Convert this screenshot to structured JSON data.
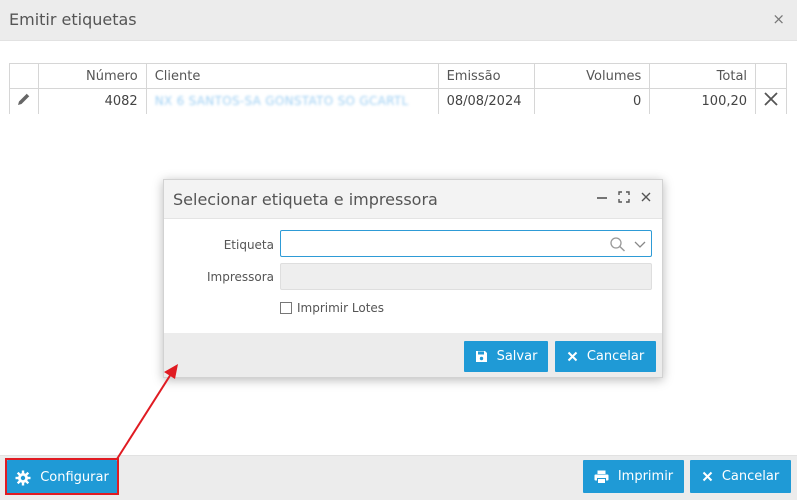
{
  "window": {
    "title": "Emitir etiquetas",
    "close_glyph": "×"
  },
  "table": {
    "columns": [
      "",
      "Número",
      "Cliente",
      "Emissão",
      "Volumes",
      "Total",
      ""
    ],
    "rows": [
      {
        "numero": "4082",
        "cliente": "NX 6 SANTOS-SA GONSTATO SO GCARTL",
        "emissao": "08/08/2024",
        "volumes": "0",
        "total": "100,20"
      }
    ]
  },
  "dialog": {
    "title": "Selecionar etiqueta e impressora",
    "etiqueta_label": "Etiqueta",
    "etiqueta_value": "",
    "impressora_label": "Impressora",
    "impressora_value": "",
    "imprimir_lotes_label": "Imprimir Lotes",
    "imprimir_lotes_checked": false,
    "save_label": "Salvar",
    "cancel_label": "Cancelar"
  },
  "footer": {
    "configure_label": "Configurar",
    "print_label": "Imprimir",
    "cancel_label": "Cancelar"
  },
  "colors": {
    "accent": "#1f9ad6",
    "highlight": "#e01b22"
  }
}
